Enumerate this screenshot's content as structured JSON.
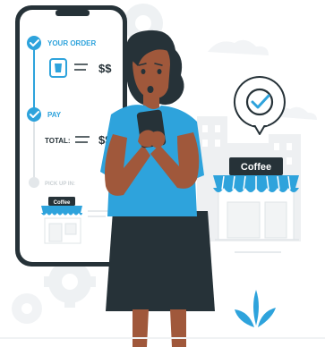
{
  "phone_app": {
    "step_order_label": "YOUR ORDER",
    "order_price": "$$",
    "step_pay_label": "PAY",
    "total_label": "TOTAL:",
    "total_price": "$$",
    "step_pickup_label": "PICK UP IN:",
    "mini_shop_sign": "Coffee"
  },
  "shop": {
    "sign_label": "Coffee"
  },
  "icons": [
    "check-icon",
    "coffee-cup-icon",
    "clock-check-icon",
    "gear-icon",
    "leaf-plant-icon",
    "awning-icon"
  ],
  "colors": {
    "accent": "#2ea3dc",
    "dark": "#263238",
    "light_gray": "#f2f4f5",
    "skin": "#a0583b"
  }
}
